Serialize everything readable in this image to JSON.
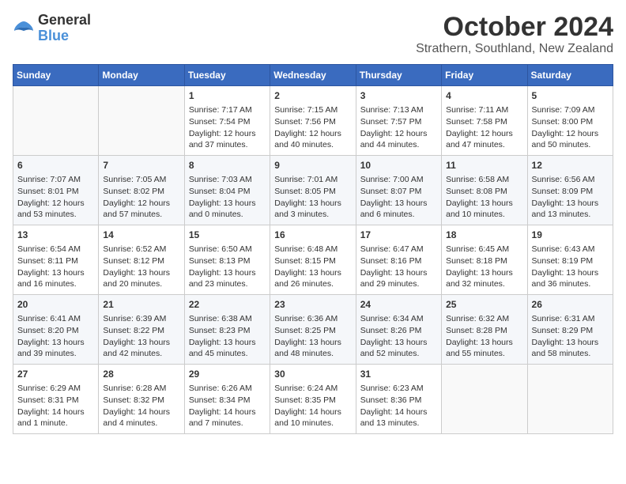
{
  "header": {
    "logo_general": "General",
    "logo_blue": "Blue",
    "month": "October 2024",
    "location": "Strathern, Southland, New Zealand"
  },
  "days_of_week": [
    "Sunday",
    "Monday",
    "Tuesday",
    "Wednesday",
    "Thursday",
    "Friday",
    "Saturday"
  ],
  "weeks": [
    [
      {
        "day": "",
        "content": ""
      },
      {
        "day": "",
        "content": ""
      },
      {
        "day": "1",
        "content": "Sunrise: 7:17 AM\nSunset: 7:54 PM\nDaylight: 12 hours and 37 minutes."
      },
      {
        "day": "2",
        "content": "Sunrise: 7:15 AM\nSunset: 7:56 PM\nDaylight: 12 hours and 40 minutes."
      },
      {
        "day": "3",
        "content": "Sunrise: 7:13 AM\nSunset: 7:57 PM\nDaylight: 12 hours and 44 minutes."
      },
      {
        "day": "4",
        "content": "Sunrise: 7:11 AM\nSunset: 7:58 PM\nDaylight: 12 hours and 47 minutes."
      },
      {
        "day": "5",
        "content": "Sunrise: 7:09 AM\nSunset: 8:00 PM\nDaylight: 12 hours and 50 minutes."
      }
    ],
    [
      {
        "day": "6",
        "content": "Sunrise: 7:07 AM\nSunset: 8:01 PM\nDaylight: 12 hours and 53 minutes."
      },
      {
        "day": "7",
        "content": "Sunrise: 7:05 AM\nSunset: 8:02 PM\nDaylight: 12 hours and 57 minutes."
      },
      {
        "day": "8",
        "content": "Sunrise: 7:03 AM\nSunset: 8:04 PM\nDaylight: 13 hours and 0 minutes."
      },
      {
        "day": "9",
        "content": "Sunrise: 7:01 AM\nSunset: 8:05 PM\nDaylight: 13 hours and 3 minutes."
      },
      {
        "day": "10",
        "content": "Sunrise: 7:00 AM\nSunset: 8:07 PM\nDaylight: 13 hours and 6 minutes."
      },
      {
        "day": "11",
        "content": "Sunrise: 6:58 AM\nSunset: 8:08 PM\nDaylight: 13 hours and 10 minutes."
      },
      {
        "day": "12",
        "content": "Sunrise: 6:56 AM\nSunset: 8:09 PM\nDaylight: 13 hours and 13 minutes."
      }
    ],
    [
      {
        "day": "13",
        "content": "Sunrise: 6:54 AM\nSunset: 8:11 PM\nDaylight: 13 hours and 16 minutes."
      },
      {
        "day": "14",
        "content": "Sunrise: 6:52 AM\nSunset: 8:12 PM\nDaylight: 13 hours and 20 minutes."
      },
      {
        "day": "15",
        "content": "Sunrise: 6:50 AM\nSunset: 8:13 PM\nDaylight: 13 hours and 23 minutes."
      },
      {
        "day": "16",
        "content": "Sunrise: 6:48 AM\nSunset: 8:15 PM\nDaylight: 13 hours and 26 minutes."
      },
      {
        "day": "17",
        "content": "Sunrise: 6:47 AM\nSunset: 8:16 PM\nDaylight: 13 hours and 29 minutes."
      },
      {
        "day": "18",
        "content": "Sunrise: 6:45 AM\nSunset: 8:18 PM\nDaylight: 13 hours and 32 minutes."
      },
      {
        "day": "19",
        "content": "Sunrise: 6:43 AM\nSunset: 8:19 PM\nDaylight: 13 hours and 36 minutes."
      }
    ],
    [
      {
        "day": "20",
        "content": "Sunrise: 6:41 AM\nSunset: 8:20 PM\nDaylight: 13 hours and 39 minutes."
      },
      {
        "day": "21",
        "content": "Sunrise: 6:39 AM\nSunset: 8:22 PM\nDaylight: 13 hours and 42 minutes."
      },
      {
        "day": "22",
        "content": "Sunrise: 6:38 AM\nSunset: 8:23 PM\nDaylight: 13 hours and 45 minutes."
      },
      {
        "day": "23",
        "content": "Sunrise: 6:36 AM\nSunset: 8:25 PM\nDaylight: 13 hours and 48 minutes."
      },
      {
        "day": "24",
        "content": "Sunrise: 6:34 AM\nSunset: 8:26 PM\nDaylight: 13 hours and 52 minutes."
      },
      {
        "day": "25",
        "content": "Sunrise: 6:32 AM\nSunset: 8:28 PM\nDaylight: 13 hours and 55 minutes."
      },
      {
        "day": "26",
        "content": "Sunrise: 6:31 AM\nSunset: 8:29 PM\nDaylight: 13 hours and 58 minutes."
      }
    ],
    [
      {
        "day": "27",
        "content": "Sunrise: 6:29 AM\nSunset: 8:31 PM\nDaylight: 14 hours and 1 minute."
      },
      {
        "day": "28",
        "content": "Sunrise: 6:28 AM\nSunset: 8:32 PM\nDaylight: 14 hours and 4 minutes."
      },
      {
        "day": "29",
        "content": "Sunrise: 6:26 AM\nSunset: 8:34 PM\nDaylight: 14 hours and 7 minutes."
      },
      {
        "day": "30",
        "content": "Sunrise: 6:24 AM\nSunset: 8:35 PM\nDaylight: 14 hours and 10 minutes."
      },
      {
        "day": "31",
        "content": "Sunrise: 6:23 AM\nSunset: 8:36 PM\nDaylight: 14 hours and 13 minutes."
      },
      {
        "day": "",
        "content": ""
      },
      {
        "day": "",
        "content": ""
      }
    ]
  ]
}
